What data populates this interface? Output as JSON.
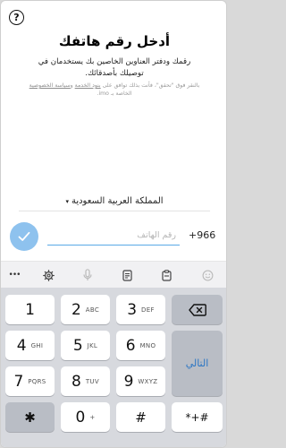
{
  "help": {
    "glyph": "?"
  },
  "header": {
    "title": "أدخل رقم هاتفك",
    "subtitle": "رقمك ودفتر العناوين الخاصين بك يستخدمان في توصيلك بأصدقائك.",
    "terms_pre": "بالنقر فوق \"تحقق\"، فأنت بذلك توافق على ",
    "terms_link": "بنود الخدمة",
    "terms_mid": " و",
    "terms_link2": "سياسة الخصوصية",
    "terms_post": " الخاصة بـ imo."
  },
  "country": {
    "name": "المملكة العربية السعودية",
    "caret": "▾"
  },
  "phone": {
    "placeholder": "رقم الهاتف",
    "value": "",
    "dial_code": "+966"
  },
  "colors": {
    "accent": "#5aa9e6",
    "submit_bg": "#8ec2ee",
    "next": "#2a75c4"
  },
  "toolbar": {
    "items": [
      "more-icon",
      "settings-icon",
      "microphone-icon",
      "clipboard-list-icon",
      "clipboard-icon",
      "emoji-icon"
    ],
    "more_glyph": "•••"
  },
  "keyboard": {
    "k1": {
      "num": "1",
      "letters": ""
    },
    "k2": {
      "num": "2",
      "letters": "ABC"
    },
    "k3": {
      "num": "3",
      "letters": "DEF"
    },
    "k4": {
      "num": "4",
      "letters": "GHI"
    },
    "k5": {
      "num": "5",
      "letters": "JKL"
    },
    "k6": {
      "num": "6",
      "letters": "MNO"
    },
    "k7": {
      "num": "7",
      "letters": "PQRS"
    },
    "k8": {
      "num": "8",
      "letters": "TUV"
    },
    "k9": {
      "num": "9",
      "letters": "WXYZ"
    },
    "k0": {
      "num": "0",
      "letters": "+"
    },
    "star": "✱",
    "hash": "#",
    "symbols": "*+#",
    "next": "التالي"
  }
}
